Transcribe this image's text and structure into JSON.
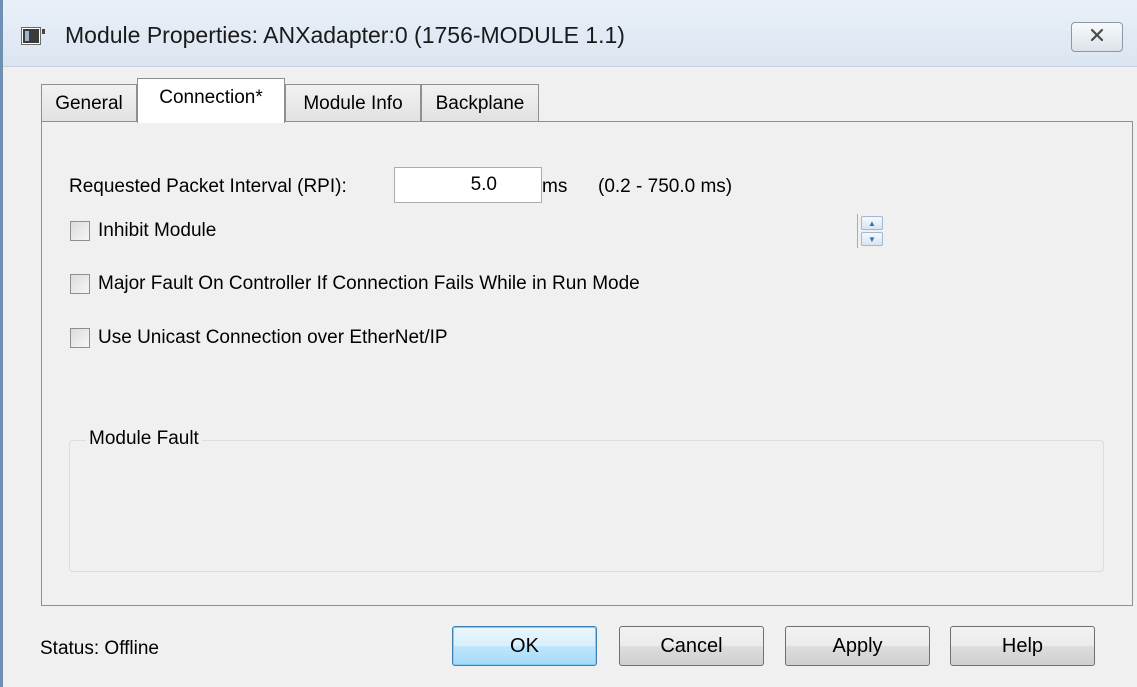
{
  "window": {
    "title": "Module Properties: ANXadapter:0 (1756-MODULE 1.1)",
    "icons": {
      "app": "module-icon",
      "close": "close-icon"
    }
  },
  "tabs": [
    {
      "label": "General",
      "active": false
    },
    {
      "label": "Connection*",
      "active": true
    },
    {
      "label": "Module Info",
      "active": false
    },
    {
      "label": "Backplane",
      "active": false
    }
  ],
  "connection": {
    "rpi_label": "Requested Packet Interval (RPI):",
    "rpi_value": "5.0",
    "rpi_unit": "ms",
    "rpi_range": "(0.2 - 750.0 ms)",
    "inhibit_label": "Inhibit Module",
    "inhibit_checked": false,
    "major_fault_label": "Major Fault On Controller If Connection Fails While in Run Mode",
    "major_fault_checked": false,
    "unicast_label": "Use Unicast Connection over EtherNet/IP",
    "unicast_checked": false,
    "module_fault_legend": "Module Fault"
  },
  "footer": {
    "status": "Status:  Offline",
    "ok": "OK",
    "cancel": "Cancel",
    "apply": "Apply",
    "help": "Help"
  },
  "colors": {
    "titlebar": "#dbe5f1",
    "dialog_bg": "#f0f0f0",
    "default_button": "#bee6fd"
  }
}
